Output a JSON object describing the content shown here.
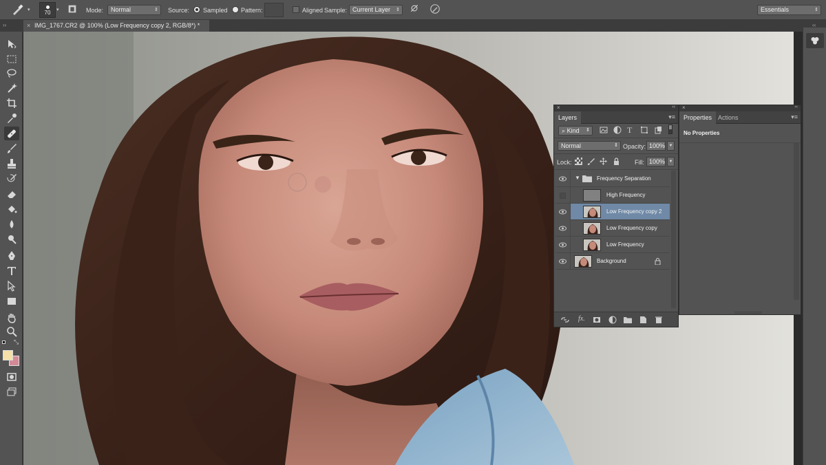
{
  "options_bar": {
    "brush_size": "70",
    "mode_label": "Mode:",
    "mode_value": "Normal",
    "source_label": "Source:",
    "sampled_label": "Sampled",
    "pattern_label": "Pattern:",
    "aligned_label": "Aligned",
    "sample_label": "Sample:",
    "sample_value": "Current Layer",
    "workspace_value": "Essentials"
  },
  "document": {
    "tab_title": "IMG_1767.CR2 @ 100% (Low Frequency copy 2, RGB/8*) *"
  },
  "layers_panel": {
    "tab_label": "Layers",
    "filter_kind": "Kind",
    "blend_mode": "Normal",
    "opacity_label": "Opacity:",
    "opacity_value": "100%",
    "lock_label": "Lock:",
    "fill_label": "Fill:",
    "fill_value": "100%",
    "layers": [
      {
        "name": "Frequency Separation",
        "type": "group",
        "visible": true,
        "selected": false
      },
      {
        "name": "High Frequency",
        "type": "gray",
        "visible": false,
        "selected": false
      },
      {
        "name": "Low Frequency copy 2",
        "type": "photo",
        "visible": true,
        "selected": true
      },
      {
        "name": "Low Frequency copy",
        "type": "photo",
        "visible": true,
        "selected": false
      },
      {
        "name": "Low Frequency",
        "type": "photo",
        "visible": true,
        "selected": false
      },
      {
        "name": "Background",
        "type": "photo",
        "visible": true,
        "selected": false,
        "locked": true
      }
    ]
  },
  "properties_panel": {
    "tab_properties": "Properties",
    "tab_actions": "Actions",
    "body_text": "No Properties"
  },
  "colors": {
    "foreground": "#f4e0a8",
    "background": "#d48a96",
    "selected_layer": "#6f89a6"
  }
}
